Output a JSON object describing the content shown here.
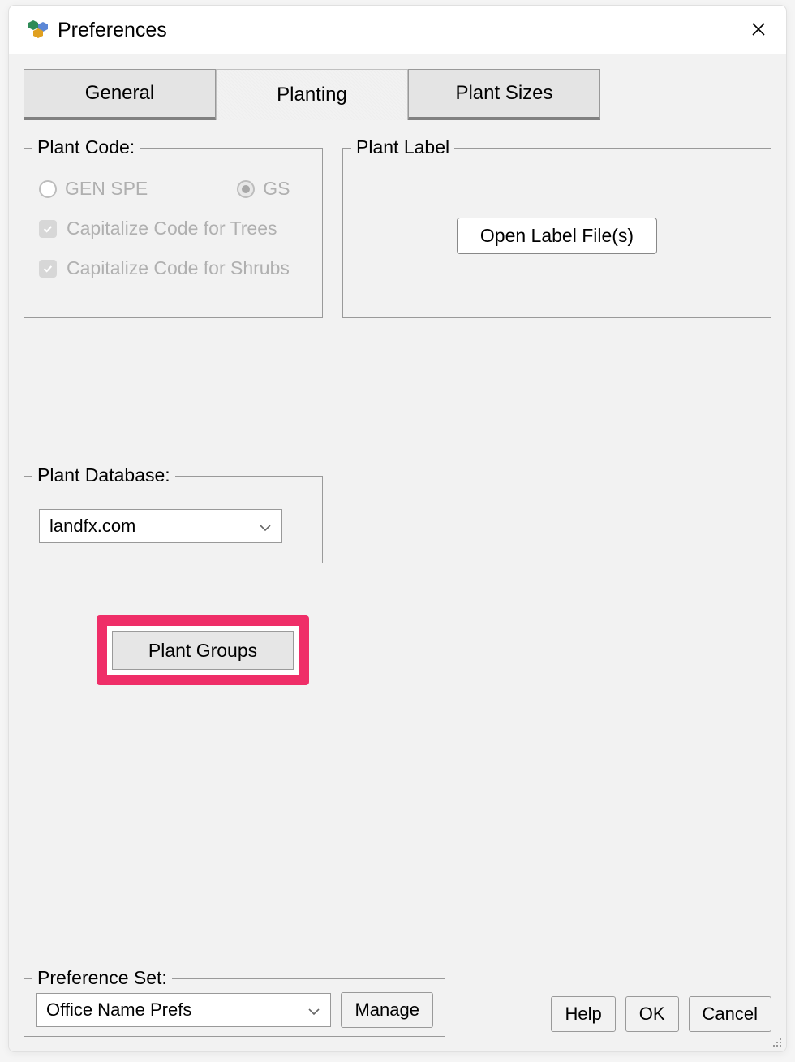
{
  "window": {
    "title": "Preferences"
  },
  "tabs": {
    "general": "General",
    "planting": "Planting",
    "plant_sizes": "Plant Sizes"
  },
  "plant_code": {
    "legend": "Plant Code:",
    "gen_spe": "GEN SPE",
    "gs": "GS",
    "cap_trees": "Capitalize Code for Trees",
    "cap_shrubs": "Capitalize Code for Shrubs"
  },
  "plant_label": {
    "legend": "Plant Label",
    "open_button": "Open Label File(s)"
  },
  "plant_database": {
    "legend": "Plant Database:",
    "value": "landfx.com"
  },
  "plant_groups_button": "Plant Groups",
  "preference_set": {
    "legend": "Preference Set:",
    "value": "Office Name Prefs",
    "manage": "Manage"
  },
  "buttons": {
    "help": "Help",
    "ok": "OK",
    "cancel": "Cancel"
  }
}
